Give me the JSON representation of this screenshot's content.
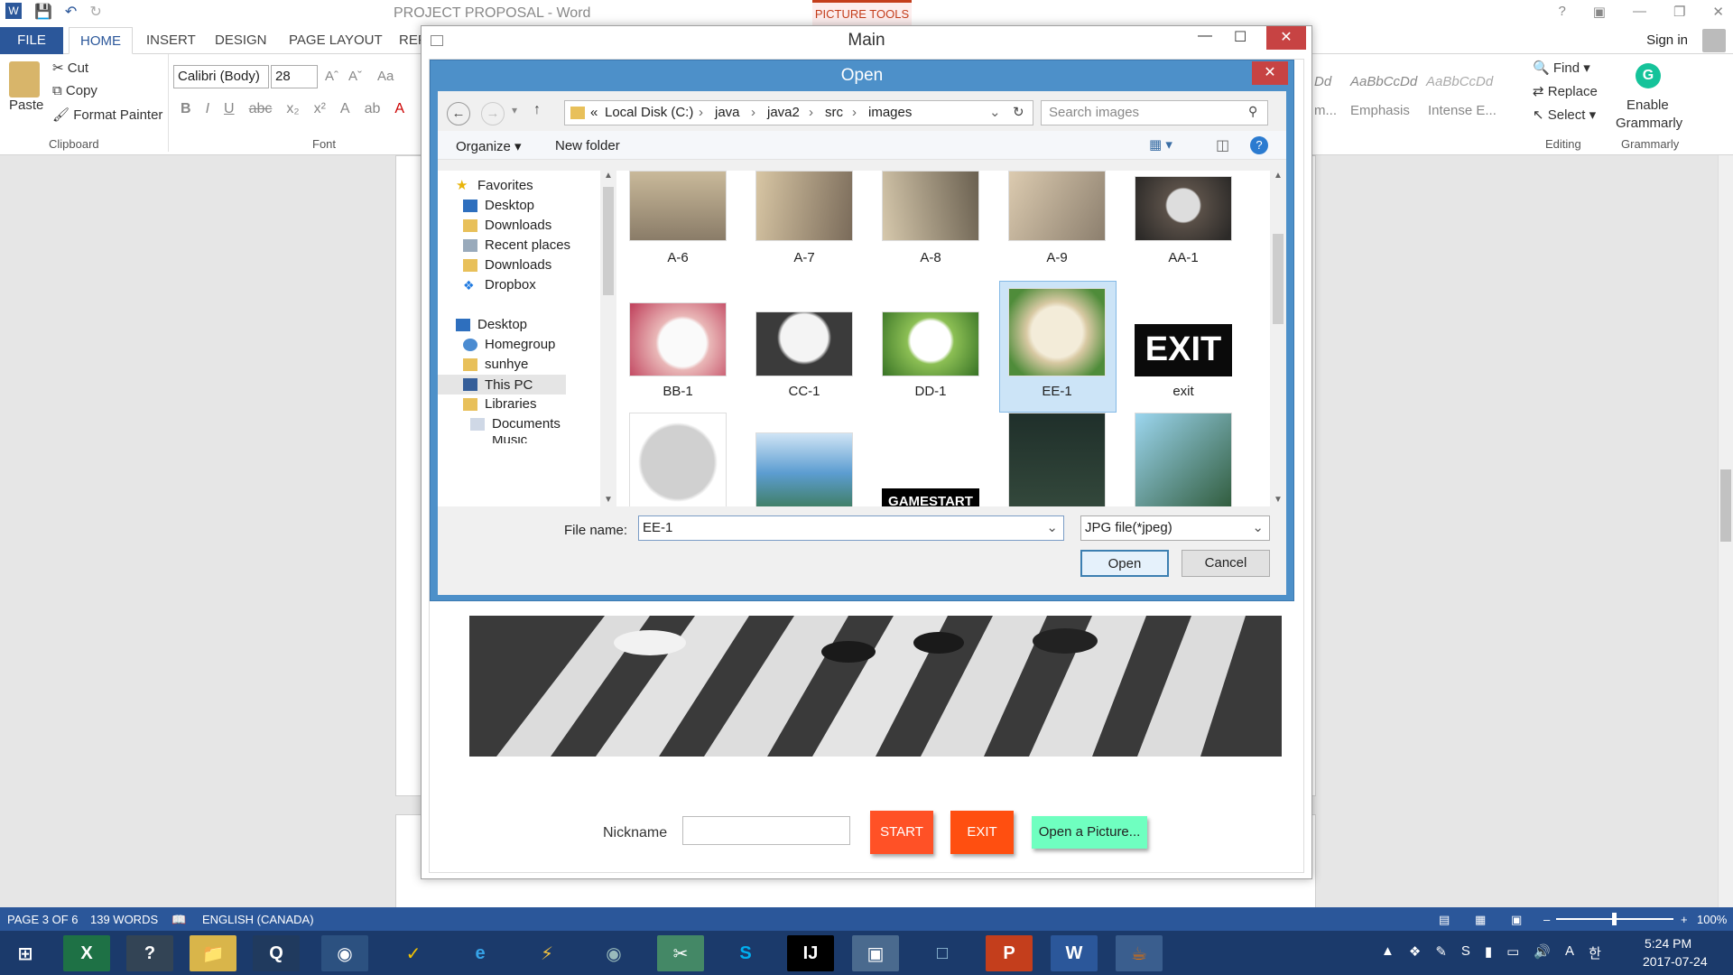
{
  "word": {
    "title": "PROJECT PROPOSAL - Word",
    "picture_tools": "PICTURE TOOLS",
    "help": "?",
    "signin": "Sign in",
    "tabs": [
      "FILE",
      "HOME",
      "INSERT",
      "DESIGN",
      "PAGE LAYOUT",
      "REF"
    ],
    "clipboard": {
      "paste": "Paste",
      "cut": "Cut",
      "copy": "Copy",
      "format_painter": "Format Painter",
      "label": "Clipboard"
    },
    "font": {
      "name": "Calibri (Body)",
      "size": "28",
      "label": "Font",
      "change_case": "Aa"
    },
    "styles": [
      "Dd",
      "AaBbCcDd",
      "AaBbCcDd"
    ],
    "style_names": [
      "m...",
      "Emphasis",
      "Intense E..."
    ],
    "editing": {
      "find": "Find",
      "replace": "Replace",
      "select": "Select",
      "label": "Editing"
    },
    "grammarly": {
      "line1": "Enable",
      "line2": "Grammarly",
      "label": "Grammarly"
    }
  },
  "status": {
    "page": "PAGE 3 OF 6",
    "words": "139 WORDS",
    "language": "ENGLISH (CANADA)",
    "zoom": "100%"
  },
  "taskbar": {
    "time": "5:24 PM",
    "date": "2017-07-24",
    "icons": [
      "start-icon",
      "excel-icon",
      "help-desk-icon",
      "file-explorer-icon",
      "quicktime-icon",
      "chrome-icon",
      "norton-icon",
      "ie-icon",
      "sticky-icon",
      "chrome-alt-icon",
      "snipping-icon",
      "skype-icon",
      "intellij-icon",
      "desktop-icon",
      "virtualbox-icon",
      "powerpoint-icon",
      "word-icon",
      "java-icon"
    ]
  },
  "main_window": {
    "title": "Main",
    "nickname_label": "Nickname",
    "nickname_value": "",
    "start": "START",
    "exit": "EXIT",
    "open_picture": "Open a Picture..."
  },
  "dialog": {
    "title": "Open",
    "address": [
      "«",
      "Local Disk (C:)",
      "java",
      "java2",
      "src",
      "images"
    ],
    "search_placeholder": "Search images",
    "organize": "Organize",
    "new_folder": "New folder",
    "nav": [
      "Favorites",
      "Desktop",
      "Downloads",
      "Recent places",
      "Downloads",
      "Dropbox",
      "Desktop",
      "Homegroup",
      "sunhye",
      "This PC",
      "Libraries",
      "Documents",
      "Music"
    ],
    "files": [
      {
        "name": "A-6"
      },
      {
        "name": "A-7"
      },
      {
        "name": "A-8"
      },
      {
        "name": "A-9"
      },
      {
        "name": "AA-1"
      },
      {
        "name": "BB-1"
      },
      {
        "name": "CC-1"
      },
      {
        "name": "DD-1"
      },
      {
        "name": "EE-1"
      },
      {
        "name": "exit"
      }
    ],
    "exit_thumb_text": "EXIT",
    "gamestart_thumb_text": "GAMESTART",
    "file_name_label": "File name:",
    "file_name_value": "EE-1",
    "file_type": "JPG file(*jpeg)",
    "open": "Open",
    "cancel": "Cancel"
  }
}
